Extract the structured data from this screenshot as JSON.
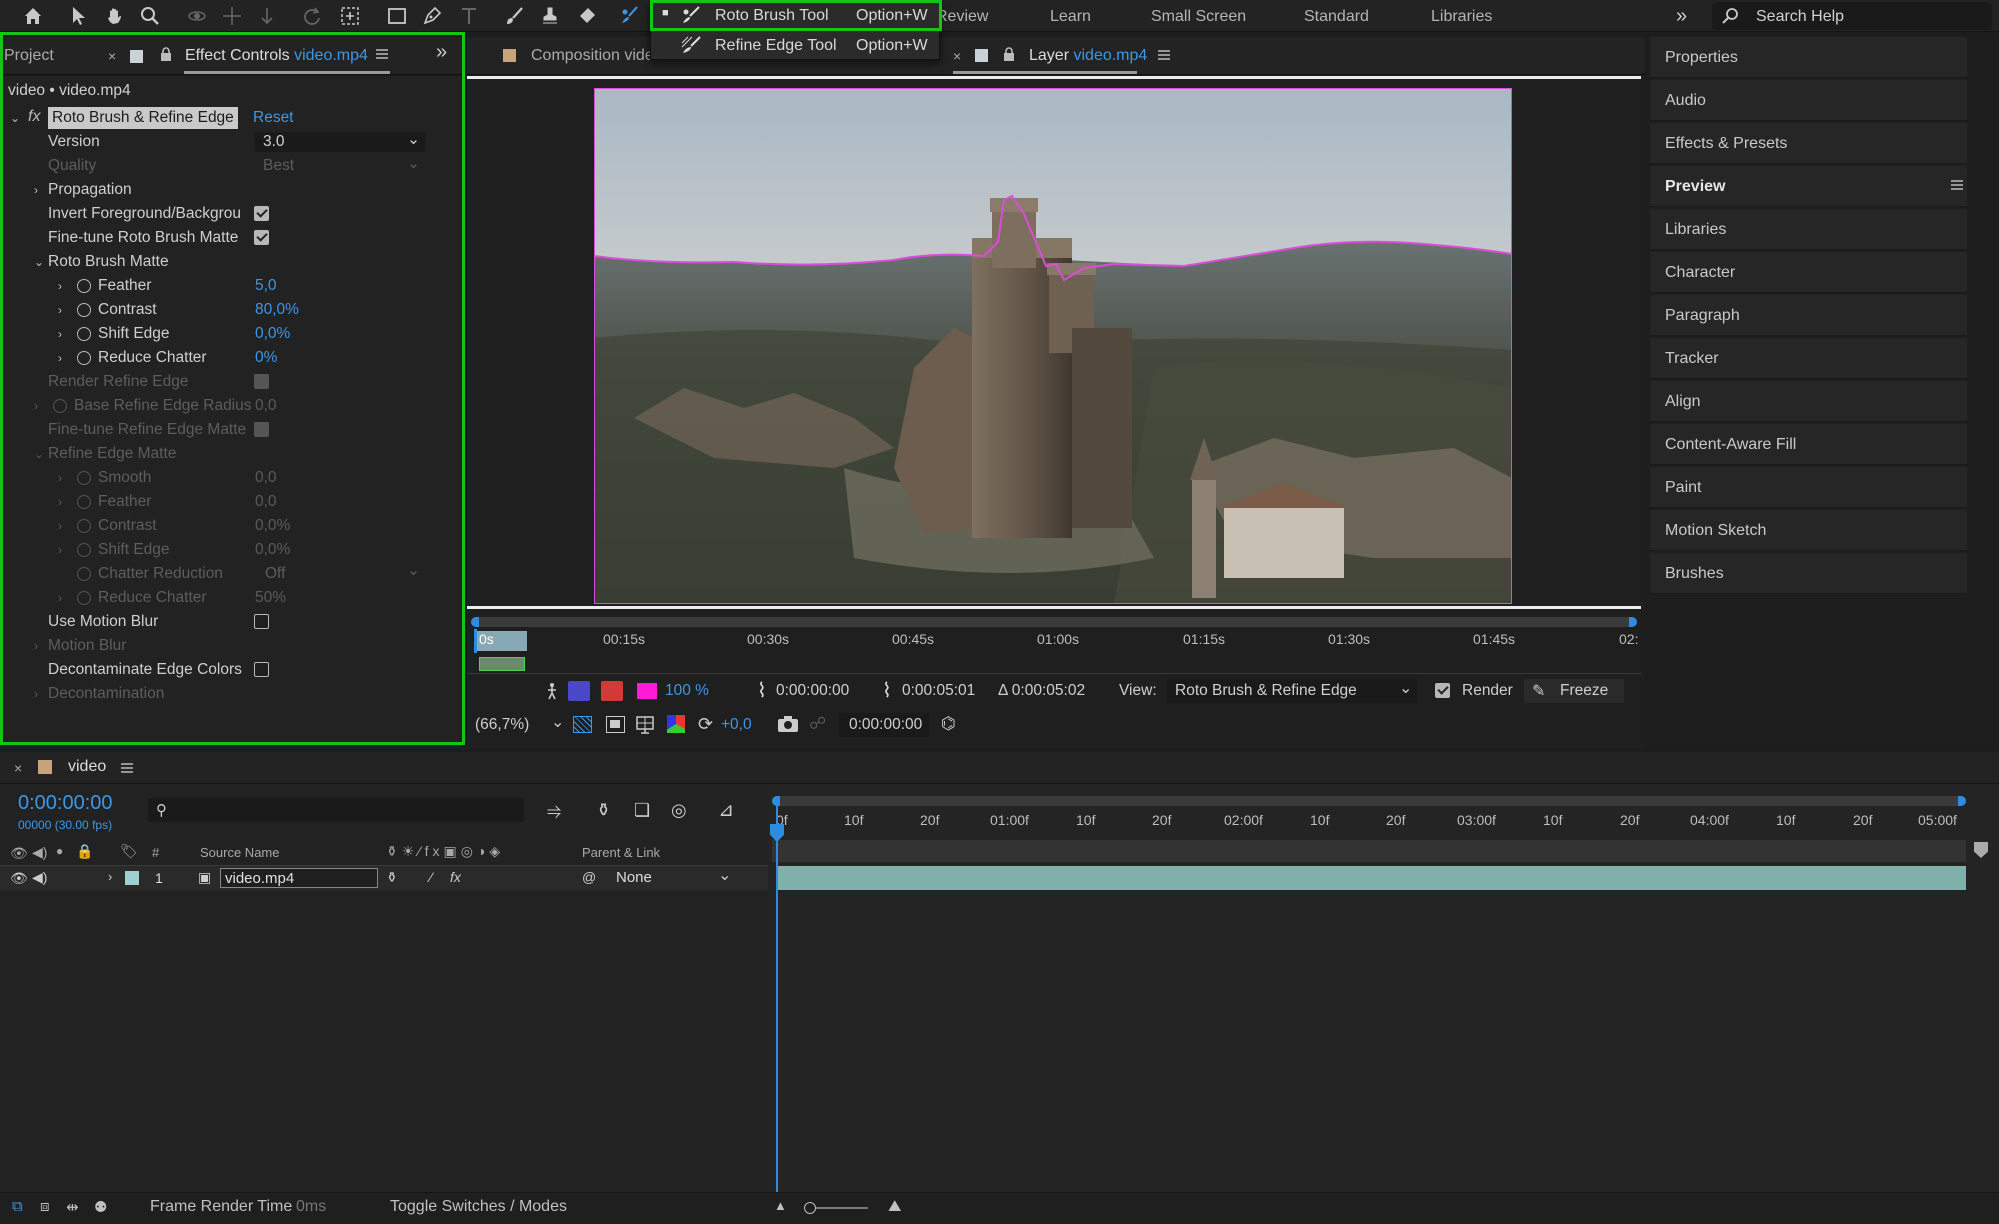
{
  "toolbar": {
    "workspaces": [
      "Review",
      "Learn",
      "Small Screen",
      "Standard",
      "Libraries"
    ],
    "search_placeholder": "Search Help",
    "overflow_label": "»"
  },
  "tool_dropdown": {
    "items": [
      {
        "label": "Roto Brush Tool",
        "shortcut": "Option+W",
        "selected": true
      },
      {
        "label": "Refine Edge Tool",
        "shortcut": "Option+W",
        "selected": false
      }
    ]
  },
  "effect_controls": {
    "tab_project": "Project",
    "tab_label": "Effect Controls",
    "tab_file": "video.mp4",
    "source_line": "video • video.mp4",
    "effect_name": "Roto Brush & Refine Edge",
    "reset_label": "Reset",
    "properties": {
      "version": {
        "label": "Version",
        "value": "3.0"
      },
      "quality": {
        "label": "Quality",
        "value": "Best"
      },
      "propagation": {
        "label": "Propagation"
      },
      "invert_fg": {
        "label": "Invert Foreground/Backgrou"
      },
      "fine_tune_roto": {
        "label": "Fine-tune Roto Brush Matte"
      },
      "roto_brush_matte": {
        "label": "Roto Brush Matte"
      },
      "feather": {
        "label": "Feather",
        "value": "5,0"
      },
      "contrast": {
        "label": "Contrast",
        "value": "80,0%"
      },
      "shift_edge": {
        "label": "Shift Edge",
        "value": "0,0%"
      },
      "reduce_chatter": {
        "label": "Reduce Chatter",
        "value": "0%"
      },
      "render_refine": {
        "label": "Render Refine Edge"
      },
      "base_refine_radius": {
        "label": "Base Refine Edge Radius",
        "value": "0,0"
      },
      "fine_tune_refine": {
        "label": "Fine-tune Refine Edge Matte"
      },
      "refine_edge_matte": {
        "label": "Refine Edge Matte"
      },
      "smooth": {
        "label": "Smooth",
        "value": "0,0"
      },
      "feather2": {
        "label": "Feather",
        "value": "0,0"
      },
      "contrast2": {
        "label": "Contrast",
        "value": "0,0%"
      },
      "shift_edge2": {
        "label": "Shift Edge",
        "value": "0,0%"
      },
      "chatter_reduction": {
        "label": "Chatter Reduction",
        "value": "Off"
      },
      "reduce_chatter2": {
        "label": "Reduce Chatter",
        "value": "50%"
      },
      "use_motion_blur": {
        "label": "Use Motion Blur"
      },
      "motion_blur": {
        "label": "Motion Blur"
      },
      "decontaminate": {
        "label": "Decontaminate Edge Colors"
      },
      "decontamination": {
        "label": "Decontamination"
      }
    }
  },
  "layer_panel": {
    "tab_composition": "Composition vide",
    "tab_layer": "Layer",
    "tab_layer_file": "video.mp4",
    "ruler_labels": [
      "0s",
      "00:15s",
      "00:30s",
      "00:45s",
      "01:00s",
      "01:15s",
      "01:30s",
      "01:45s",
      "02:"
    ],
    "zoom_percent": "100 %",
    "in_time": "0:00:00:00",
    "out_time": "0:00:05:01",
    "duration": "Δ 0:00:05:02",
    "view_label": "View:",
    "view_value": "Roto Brush & Refine Edge",
    "render_label": "Render",
    "freeze_label": "Freeze",
    "magnification": "(66,7%)",
    "exposure": "+0,0",
    "current_time": "0:00:00:00"
  },
  "right_panel": {
    "items": [
      "Properties",
      "Audio",
      "Effects & Presets",
      "Preview",
      "Libraries",
      "Character",
      "Paragraph",
      "Tracker",
      "Align",
      "Content-Aware Fill",
      "Paint",
      "Motion Sketch",
      "Brushes"
    ]
  },
  "timeline": {
    "comp_name": "video",
    "timecode": "0:00:00:00",
    "fps_label": "00000 (30.00 fps)",
    "search_placeholder": "",
    "col_hash": "#",
    "col_source": "Source Name",
    "col_parent": "Parent & Link",
    "layer": {
      "index": "1",
      "name": "video.mp4",
      "parent": "None"
    },
    "ruler_labels": [
      "0f",
      "10f",
      "20f",
      "01:00f",
      "10f",
      "20f",
      "02:00f",
      "10f",
      "20f",
      "03:00f",
      "10f",
      "20f",
      "04:00f",
      "10f",
      "20f",
      "05:00f"
    ]
  },
  "status_bar": {
    "frame_render_label": "Frame Render Time",
    "frame_render_value": "0ms",
    "toggle_label": "Toggle Switches / Modes"
  },
  "colors": {
    "accent_blue": "#2e8ce0",
    "highlight_green": "#13c613",
    "mask_magenta": "#d94dd9",
    "layer_bar": "#7fb0ab"
  }
}
